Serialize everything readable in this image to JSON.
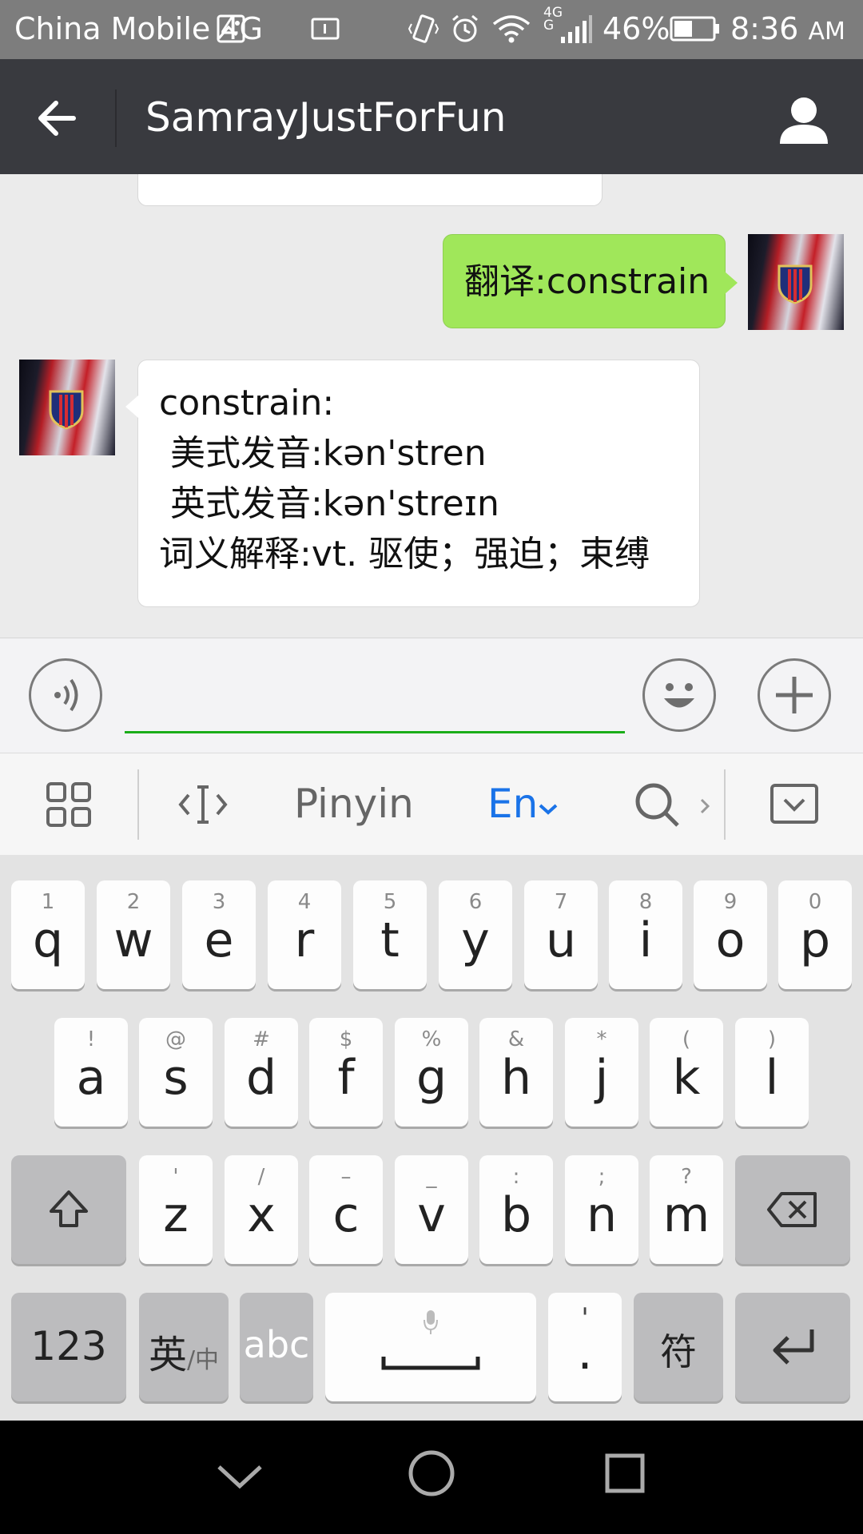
{
  "status_bar": {
    "carrier": "China Mobile 4G",
    "network_label_top": "4G",
    "network_label_bottom": "G",
    "battery": "46%",
    "time": "8:36",
    "ampm": "AM",
    "icons": [
      "image-icon",
      "sim-icon",
      "vibrate-icon",
      "alarm-icon",
      "wifi-icon",
      "signal-icon",
      "battery-icon"
    ]
  },
  "header": {
    "title": "SamrayJustForFun"
  },
  "messages": [
    {
      "side": "right",
      "text": "翻译:constrain"
    },
    {
      "side": "left",
      "lines": [
        "constrain:",
        " 美式发音:kən'stren",
        " 英式发音:kən'streɪn",
        "词义解释:vt. 驱使；强迫；束缚"
      ]
    }
  ],
  "input": {
    "value": "",
    "placeholder": ""
  },
  "keyboard_toolbar": {
    "pinyin": "Pinyin",
    "en": "En",
    "accent_color": "#1a73e8"
  },
  "keyboard": {
    "row1": [
      {
        "sec": "1",
        "key": "q"
      },
      {
        "sec": "2",
        "key": "w"
      },
      {
        "sec": "3",
        "key": "e"
      },
      {
        "sec": "4",
        "key": "r"
      },
      {
        "sec": "5",
        "key": "t"
      },
      {
        "sec": "6",
        "key": "y"
      },
      {
        "sec": "7",
        "key": "u"
      },
      {
        "sec": "8",
        "key": "i"
      },
      {
        "sec": "9",
        "key": "o"
      },
      {
        "sec": "0",
        "key": "p"
      }
    ],
    "row2": [
      {
        "sec": "!",
        "key": "a"
      },
      {
        "sec": "@",
        "key": "s"
      },
      {
        "sec": "#",
        "key": "d"
      },
      {
        "sec": "$",
        "key": "f"
      },
      {
        "sec": "%",
        "key": "g"
      },
      {
        "sec": "&",
        "key": "h"
      },
      {
        "sec": "*",
        "key": "j"
      },
      {
        "sec": "(",
        "key": "k"
      },
      {
        "sec": ")",
        "key": "l"
      }
    ],
    "row3": [
      {
        "sec": "'",
        "key": "z"
      },
      {
        "sec": "/",
        "key": "x"
      },
      {
        "sec": "–",
        "key": "c"
      },
      {
        "sec": "_",
        "key": "v"
      },
      {
        "sec": ":",
        "key": "b"
      },
      {
        "sec": ";",
        "key": "n"
      },
      {
        "sec": "?",
        "key": "m"
      }
    ],
    "num_key": "123",
    "lang_key_main": "英",
    "lang_key_sub": "/中",
    "abc_key": "abc",
    "punct_key_sec": "'",
    "punct_key": ".",
    "symbol_key": "符"
  }
}
